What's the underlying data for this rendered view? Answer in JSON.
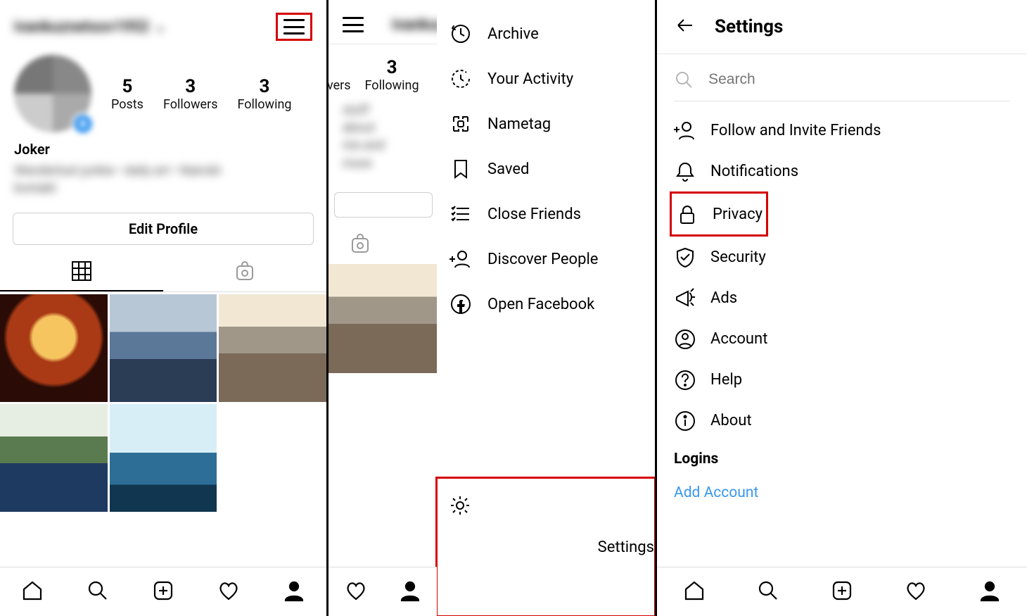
{
  "panelA": {
    "username": "ivankuznetsov1952",
    "stats": {
      "posts": "5",
      "followers": "3",
      "following": "3",
      "posts_lbl": "Posts",
      "followers_lbl": "Followers",
      "following_lbl": "Following"
    },
    "display_name": "Joker",
    "bio_line1": "Wanderlust junkie • daily art • Nairobi",
    "bio_line2": "kontakt",
    "edit_profile": "Edit Profile"
  },
  "panelB": {
    "username": "ivankuznetsov1952",
    "stats": {
      "followers_frag": "vers",
      "following": "3",
      "followers_lbl": "vers",
      "following_lbl": "Following"
    },
    "bio_frag": "stuff about me and more",
    "drawer": {
      "archive": "Archive",
      "activity": "Your Activity",
      "nametag": "Nametag",
      "saved": "Saved",
      "close_friends": "Close Friends",
      "discover": "Discover People",
      "open_fb": "Open Facebook",
      "settings": "Settings"
    }
  },
  "panelC": {
    "title": "Settings",
    "search_placeholder": "Search",
    "items": {
      "follow": "Follow and Invite Friends",
      "notifications": "Notifications",
      "privacy": "Privacy",
      "security": "Security",
      "ads": "Ads",
      "account": "Account",
      "help": "Help",
      "about": "About"
    },
    "logins_heading": "Logins",
    "add_account": "Add Account"
  }
}
